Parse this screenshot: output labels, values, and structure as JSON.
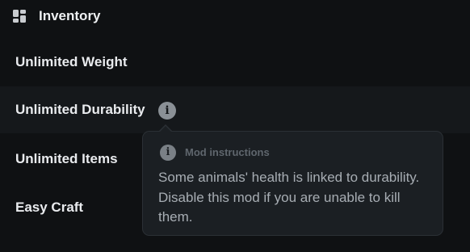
{
  "section": {
    "title": "Inventory",
    "icon": "grid-icon"
  },
  "mods": [
    {
      "label": "Unlimited Weight"
    },
    {
      "label": "Unlimited Durability",
      "has_info": true
    },
    {
      "label": "Unlimited Items"
    },
    {
      "label": "Easy Craft"
    }
  ],
  "tooltip": {
    "icon": "info-icon",
    "title": "Mod instructions",
    "body": "Some animals' health is linked to durability. Disable this mod if you are unable to kill them."
  },
  "colors": {
    "background": "#0f1113",
    "row_highlight": "#15181b",
    "tooltip_bg": "#1b1f23",
    "text": "#e9ebee",
    "muted_text": "#a7adb3"
  }
}
